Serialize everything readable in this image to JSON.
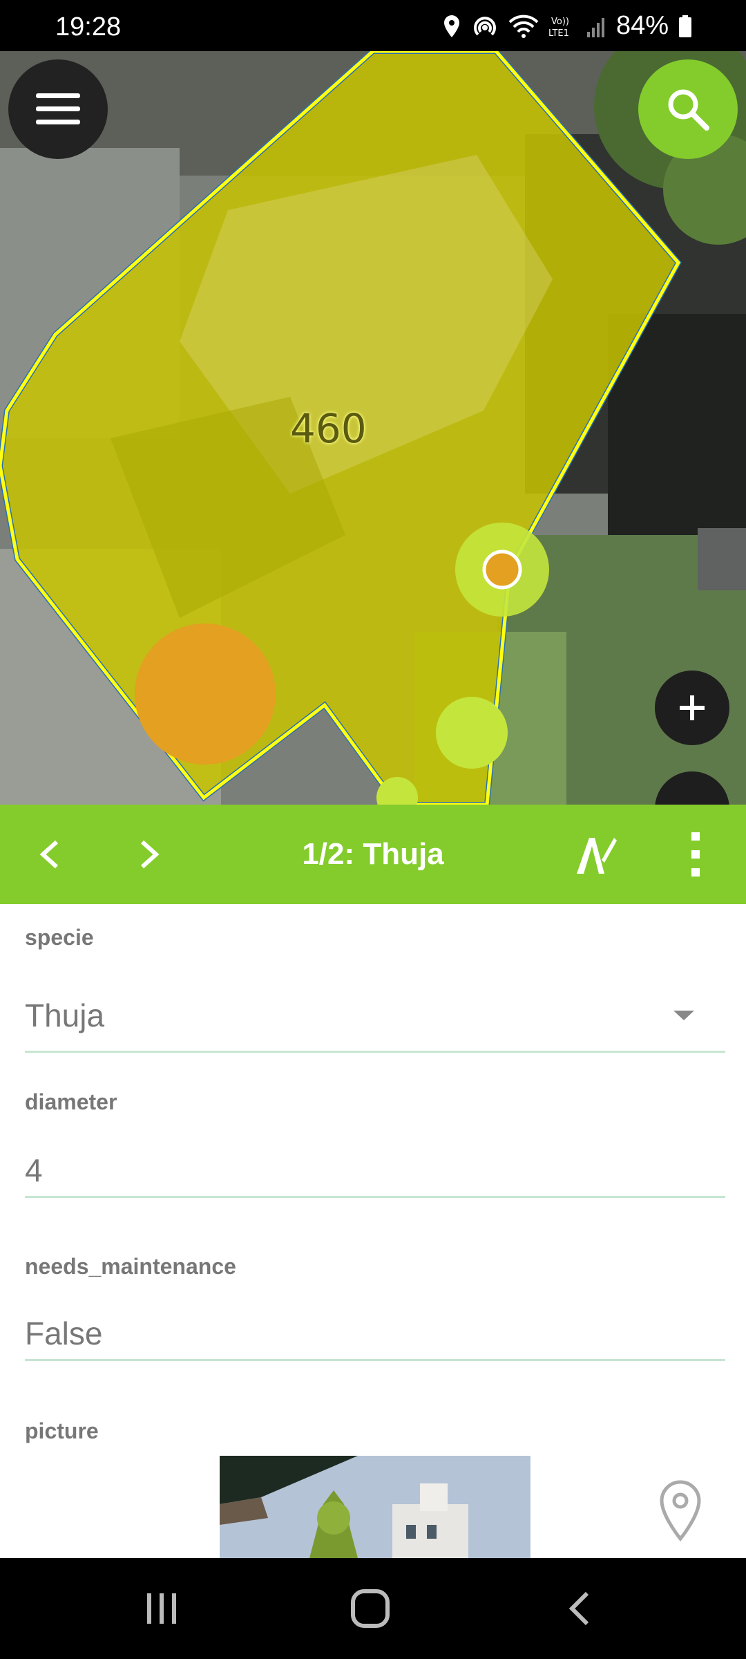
{
  "status_bar": {
    "time": "19:28",
    "battery": "84%",
    "icons": [
      "location-icon",
      "hotspot-icon",
      "wifi-icon",
      "volte-icon",
      "signal-icon",
      "battery-icon"
    ]
  },
  "map": {
    "feature_label": "460",
    "buttons": [
      "menu-icon",
      "search-icon",
      "zoom-in-icon"
    ],
    "colors": {
      "polygon_fill": "#c8c800",
      "polygon_stroke": "#ffff00",
      "point_orange": "#e4a020",
      "point_lime": "#c4e63c"
    }
  },
  "toolbar": {
    "title": "1/2: Thuja",
    "icons": [
      "chevron-left-icon",
      "chevron-right-icon",
      "edit-icon",
      "more-vert-icon"
    ],
    "color": "#84cc2c"
  },
  "form": {
    "fields": [
      {
        "label": "specie",
        "value": "Thuja",
        "type": "dropdown"
      },
      {
        "label": "diameter",
        "value": "4",
        "type": "text"
      },
      {
        "label": "needs_maintenance",
        "value": "False",
        "type": "text"
      },
      {
        "label": "picture",
        "type": "image"
      }
    ]
  },
  "nav_bar": {
    "icons": [
      "recent-apps-icon",
      "home-icon",
      "back-icon"
    ]
  }
}
